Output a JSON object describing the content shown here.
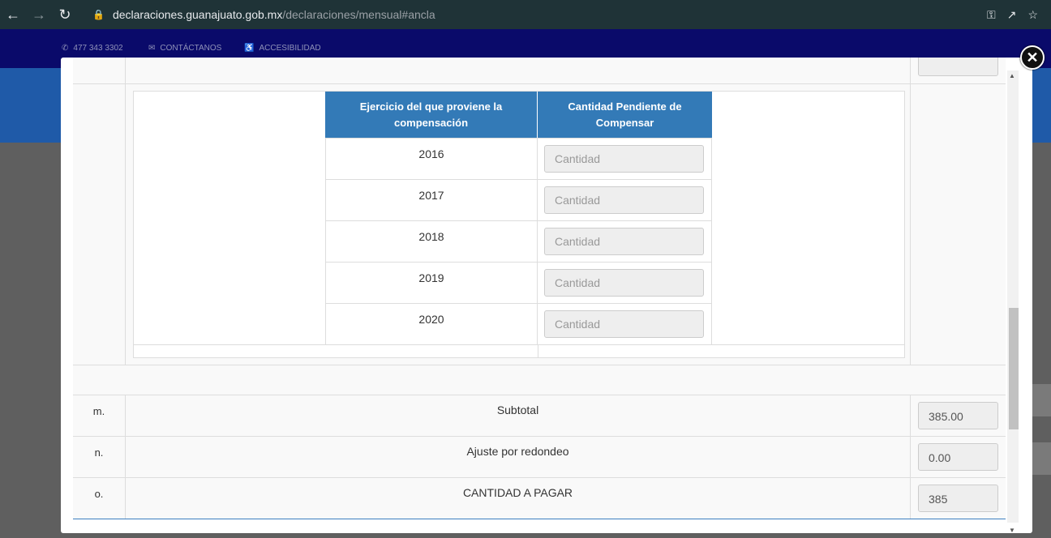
{
  "browser": {
    "url_domain": "declaraciones.guanajuato.gob.mx",
    "url_path": "/declaraciones/mensual#ancla"
  },
  "site_topbar": {
    "phone": "477 343 3302",
    "contact": "CONTÁCTANOS",
    "accessibility": "ACCESIBILIDAD"
  },
  "compensation_table": {
    "header_year": "Ejercicio del que proviene la compensación",
    "header_amount": "Cantidad Pendiente de Compensar",
    "rows": [
      {
        "year": "2016",
        "placeholder": "Cantidad"
      },
      {
        "year": "2017",
        "placeholder": "Cantidad"
      },
      {
        "year": "2018",
        "placeholder": "Cantidad"
      },
      {
        "year": "2019",
        "placeholder": "Cantidad"
      },
      {
        "year": "2020",
        "placeholder": "Cantidad"
      }
    ]
  },
  "summary_rows": [
    {
      "letter": "m.",
      "label": "Subtotal",
      "value": "385.00"
    },
    {
      "letter": "n.",
      "label": "Ajuste por redondeo",
      "value": "0.00"
    },
    {
      "letter": "o.",
      "label": "CANTIDAD A PAGAR",
      "value": "385"
    }
  ],
  "colors": {
    "header_blue": "#337ab7",
    "navy_bar": "#0a0a6a"
  }
}
